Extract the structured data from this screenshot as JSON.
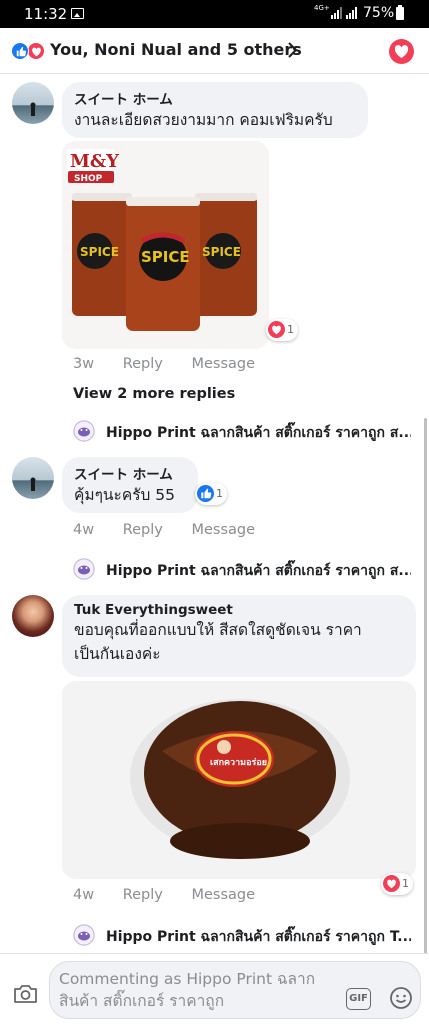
{
  "status_bar": {
    "time": "11:32",
    "network": "4G+",
    "battery": "75%"
  },
  "header": {
    "reactions_text": "You, Noni Nual and 5 others",
    "like_icon": "like-icon",
    "love_icon": "heart-icon"
  },
  "comments": [
    {
      "author": "スイート ホーム",
      "text": "งานละเอียดสวยงามมาก คอมเฟริมครับ",
      "time": "3w",
      "reply_label": "Reply",
      "message_label": "Message",
      "reaction_count": "1",
      "photo_shop_text_top": "M&Y",
      "photo_shop_text_bottom": "SHOP",
      "photo_jar_label": "SPICE"
    },
    {
      "author": "スイート ホーム",
      "text": "คุ้มๆนะครับ 55",
      "time": "4w",
      "reply_label": "Reply",
      "message_label": "Message",
      "reaction_count": "1"
    },
    {
      "author": "Tuk Everythingsweet",
      "text_line1": "ขอบคุณที่ออกแบบให้ สีสดใสดูชัดเจน ราคา",
      "text_line2": "เป็นกันเองค่ะ",
      "time": "4w",
      "reply_label": "Reply",
      "message_label": "Message",
      "reaction_count": "1",
      "photo_label_text": "เสกความอร่อย"
    }
  ],
  "view_more_replies": "View 2 more replies",
  "replies": [
    {
      "text": "Hippo Print ฉลากสินค้า สติ๊กเกอร์ ราคาถูก ส..."
    },
    {
      "text": "Hippo Print ฉลากสินค้า สติ๊กเกอร์ ราคาถูก ส..."
    },
    {
      "text": "Hippo Print ฉลากสินค้า สติ๊กเกอร์ ราคาถูก T..."
    }
  ],
  "composer": {
    "placeholder_line1": "Commenting as Hippo Print ฉลาก",
    "placeholder_line2": "สินค้า สติ๊กเกอร์ ราคาถูก",
    "gif_label": "GIF"
  },
  "colors": {
    "like_blue": "#1877f2",
    "love_red": "#f33e58",
    "bubble_bg": "#f0f2f5",
    "meta_gray": "#8a8d91"
  }
}
